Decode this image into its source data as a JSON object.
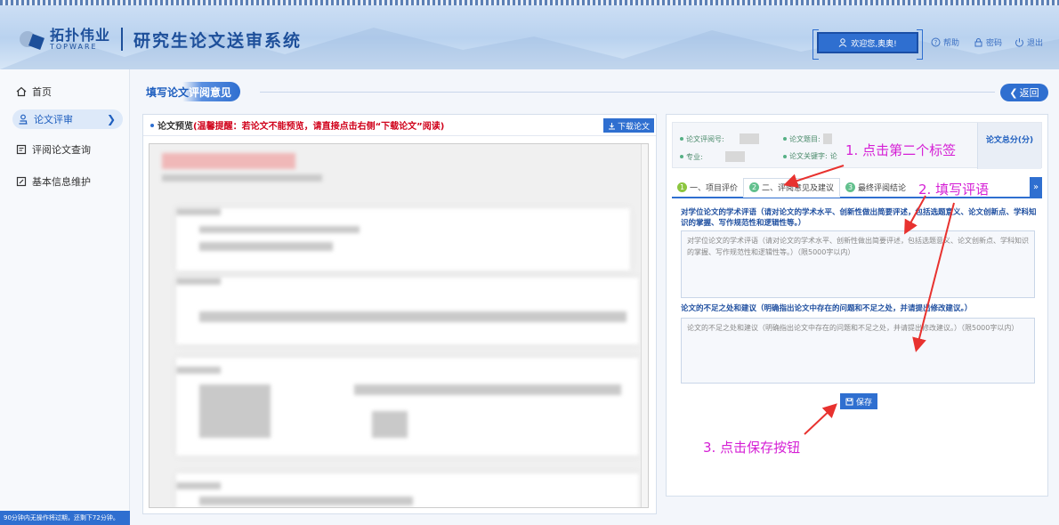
{
  "header": {
    "logo_cn": "拓扑伟业",
    "logo_en": "TOPWARE",
    "system_title": "研究生论文送审系统",
    "welcome": "欢迎您,奥奥!",
    "help": "帮助",
    "password": "密码",
    "logout": "退出"
  },
  "sidebar": {
    "items": [
      {
        "label": "首页",
        "icon": "home-icon"
      },
      {
        "label": "论文评审",
        "icon": "user-review-icon"
      },
      {
        "label": "评阅论文查询",
        "icon": "document-search-icon"
      },
      {
        "label": "基本信息维护",
        "icon": "info-edit-icon"
      }
    ],
    "timer_text": "90分钟内无操作将过期，还剩下72分钟。"
  },
  "main": {
    "page_title_a": "填写论文",
    "page_title_b": "评阅意见",
    "back_label": "返回"
  },
  "preview": {
    "header_prefix": "论文预览",
    "header_warning": "(温馨提醒：若论文不能预览，请直接点击右侧“下载论文”阅读)",
    "download_label": "下载论文"
  },
  "info": {
    "review_no_label": "论文评阅号:",
    "topic_label": "论文题目:",
    "topic_value_visible": "论",
    "major_label": "专业:",
    "keywords_label": "论文关键字:",
    "keywords_value_visible": "论",
    "score_label": "论文总分(分)"
  },
  "tabs": [
    {
      "num": "1",
      "label": "一、项目评价"
    },
    {
      "num": "2",
      "label": "二、评阅意见及建议"
    },
    {
      "num": "3",
      "label": "最终评阅结论"
    }
  ],
  "form": {
    "q1_label": "对学位论文的学术评语（请对论文的学术水平、创新性做出简要评述，包括选题意义、论文创新点、学科知识的掌握、写作规范性和逻辑性等。）",
    "q1_placeholder": "对学位论文的学术评语（请对论文的学术水平、创新性做出简要评述，包括选题意义、论文创新点、学科知识的掌握、写作规范性和逻辑性等。）（限5000字以内）",
    "q2_label": "论文的不足之处和建议（明确指出论文中存在的问题和不足之处，并请提出修改建议。）",
    "q2_placeholder": "论文的不足之处和建议（明确指出论文中存在的问题和不足之处，并请提出修改建议。）（限5000字以内）",
    "save_label": "保存"
  },
  "annotations": {
    "step1": "1. 点击第二个标签",
    "step2": "2. 填写评语",
    "step3": "3. 点击保存按钮"
  },
  "colors": {
    "primary": "#2f6fd0",
    "annotation": "#d51fd5",
    "warning": "#d0021b"
  }
}
